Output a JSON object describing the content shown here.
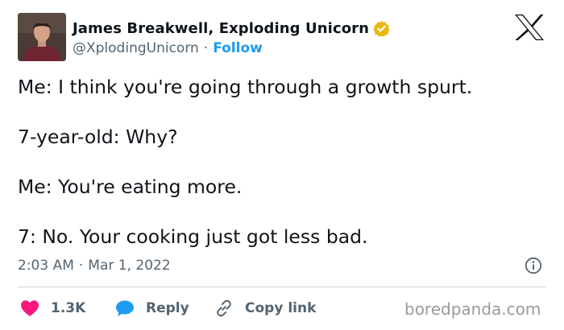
{
  "author": {
    "display_name": "James Breakwell, Exploding Unicorn",
    "handle": "@XplodingUnicorn",
    "separator": "·",
    "follow_label": "Follow",
    "verified_icon": "verified-badge-icon",
    "verified_color": "#e8b80c"
  },
  "brand_icon": "x-logo-icon",
  "tweet": {
    "lines": [
      "Me: I think you're going through a growth spurt.",
      "7-year-old: Why?",
      "Me: You're eating more.",
      "7: No. Your cooking just got less bad."
    ]
  },
  "meta": {
    "time": "2:03 AM",
    "separator": "·",
    "date": "Mar 1, 2022",
    "info_icon": "info-icon"
  },
  "actions": {
    "like": {
      "icon": "heart-icon",
      "label": "1.3K",
      "color": "#f91880"
    },
    "reply": {
      "icon": "speech-bubble-icon",
      "label": "Reply",
      "color": "#1d9bf0"
    },
    "copy": {
      "icon": "link-icon",
      "label": "Copy link",
      "color": "#536471"
    }
  },
  "watermark": "boredpanda.com",
  "colors": {
    "text": "#0f1419",
    "secondary": "#536471",
    "accent": "#1d9bf0",
    "divider": "#cfd9de"
  }
}
